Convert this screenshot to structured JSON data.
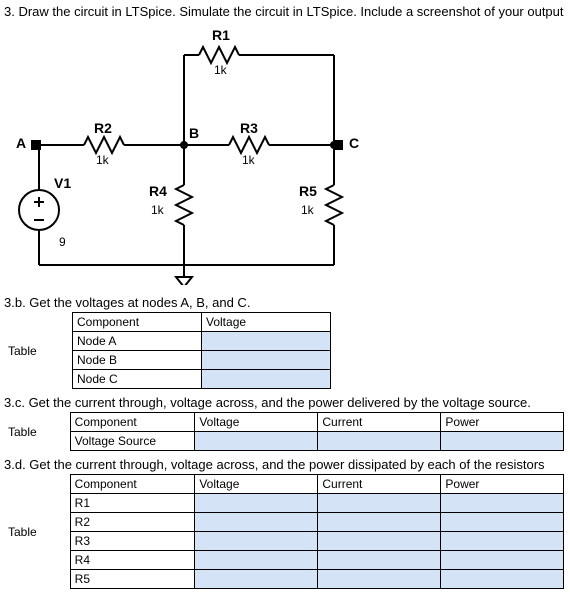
{
  "question": "3. Draw the circuit in LTSpice. Simulate the circuit in LTSpice. Include a screenshot of your output",
  "circuit": {
    "R1": {
      "name": "R1",
      "value": "1k"
    },
    "R2": {
      "name": "R2",
      "value": "1k"
    },
    "R3": {
      "name": "R3",
      "value": "1k"
    },
    "R4": {
      "name": "R4",
      "value": "1k"
    },
    "R5": {
      "name": "R5",
      "value": "1k"
    },
    "V1": {
      "name": "V1",
      "value": "9"
    },
    "nodes": {
      "A": "A",
      "B": "B",
      "C": "C"
    }
  },
  "b": {
    "prompt": "3.b. Get the voltages at nodes A, B, and C.",
    "table_label": "Table",
    "headers": {
      "component": "Component",
      "voltage": "Voltage"
    },
    "rows": [
      "Node A",
      "Node B",
      "Node C"
    ]
  },
  "c": {
    "prompt": "3.c. Get the current through, voltage across, and the power delivered by the voltage source.",
    "table_label": "Table",
    "headers": {
      "component": "Component",
      "voltage": "Voltage",
      "current": "Current",
      "power": "Power"
    },
    "rows": [
      "Voltage Source"
    ]
  },
  "d": {
    "prompt": "3.d. Get the current through, voltage across, and the power dissipated by each of the resistors",
    "table_label": "Table",
    "headers": {
      "component": "Component",
      "voltage": "Voltage",
      "current": "Current",
      "power": "Power"
    },
    "rows": [
      "R1",
      "R2",
      "R3",
      "R4",
      "R5"
    ]
  }
}
